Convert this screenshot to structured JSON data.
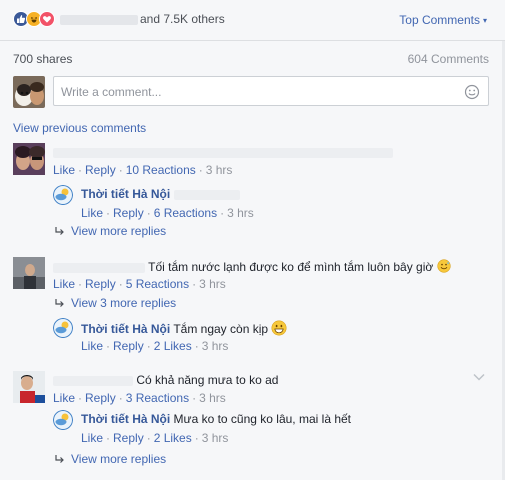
{
  "reactions": {
    "names_suffix": "and 7.5K others",
    "types": [
      "like-icon",
      "haha-icon",
      "love-icon"
    ],
    "top_comments_label": "Top Comments"
  },
  "stats": {
    "shares": "700 shares",
    "comments": "604 Comments"
  },
  "composer": {
    "placeholder": "Write a comment..."
  },
  "view_previous": "View previous comments",
  "comments": [
    {
      "text": "",
      "actions": {
        "like": "Like",
        "reply": "Reply",
        "reactions": "10 Reactions",
        "time": "3 hrs"
      },
      "reply": {
        "name": "Thời tiết Hà Nội",
        "text": "",
        "actions": {
          "like": "Like",
          "reply": "Reply",
          "reactions": "6 Reactions",
          "time": "3 hrs"
        }
      },
      "view_more": "View more replies"
    },
    {
      "text": "Tối tắm nước lạnh được ko để mình tắm luôn bây giờ",
      "actions": {
        "like": "Like",
        "reply": "Reply",
        "reactions": "5 Reactions",
        "time": "3 hrs"
      },
      "view_more": "View 3 more replies",
      "reply": {
        "name": "Thời tiết Hà Nội",
        "text": "Tắm ngay còn kịp",
        "actions": {
          "like": "Like",
          "reply": "Reply",
          "reactions": "2 Likes",
          "time": "3 hrs"
        }
      }
    },
    {
      "text": "Có khả năng mưa to ko ad",
      "actions": {
        "like": "Like",
        "reply": "Reply",
        "reactions": "3 Reactions",
        "time": "3 hrs"
      },
      "reply": {
        "name": "Thời tiết Hà Nội",
        "text": "Mưa ko to cũng ko lâu, mai là hết",
        "actions": {
          "like": "Like",
          "reply": "Reply",
          "reactions": "2 Likes",
          "time": "3 hrs"
        }
      },
      "view_more": "View more replies"
    }
  ],
  "colors": {
    "link": "#4267b2",
    "name": "#365899",
    "muted": "#90949c",
    "bg": "#f6f7f9"
  }
}
